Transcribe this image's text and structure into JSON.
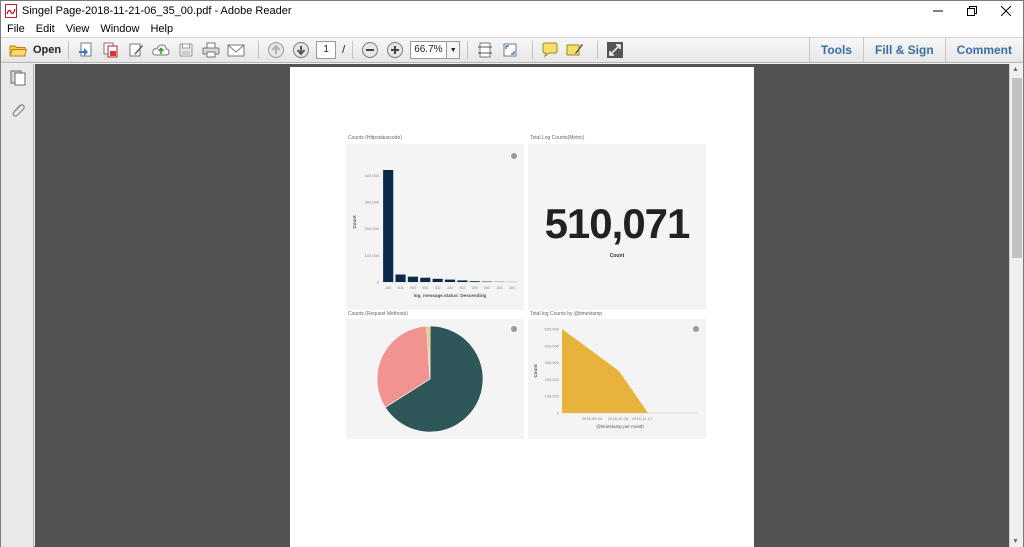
{
  "window": {
    "title": "Singel Page-2018-11-21-06_35_00.pdf - Adobe Reader"
  },
  "menu": [
    "File",
    "Edit",
    "View",
    "Window",
    "Help"
  ],
  "toolbar": {
    "open_label": "Open",
    "page_current": "1",
    "page_separator": "/",
    "zoom": "66.7%",
    "tools_label": "Tools",
    "fillsign_label": "Fill & Sign",
    "comment_label": "Comment"
  },
  "icons": {
    "pdf": "pdf-file-icon",
    "open": "folder-icon",
    "print": "printer-icon",
    "email": "envelope-icon"
  },
  "colors": {
    "bar": "#0b2a4a",
    "pie_main": "#2f5659",
    "pie_second": "#f09391",
    "pie_third": "#e6c76c",
    "area": "#e8b33b",
    "link": "#3b6ea6"
  },
  "dashboard": {
    "p1_title": "Counts (Httpstatuscode)",
    "p2_title": "Total Log Counts(Metric)",
    "p3_title": "Counts (Request Methods)",
    "p4_title": "Total log Counts by @timestamp",
    "metric_value": "510,071",
    "metric_label": "Count"
  },
  "chart_data": [
    {
      "type": "bar",
      "title": "Counts (Httpstatuscode)",
      "xlabel": "log_message.status: Descending",
      "ylabel": "Count",
      "categories": [
        "200",
        "404",
        "403",
        "400",
        "302",
        "304",
        "502",
        "206",
        "500",
        "302",
        "204"
      ],
      "values": [
        420000,
        28000,
        20000,
        16000,
        12000,
        9000,
        6000,
        3000,
        1500,
        800,
        400
      ],
      "yticks": [
        "0",
        "100,000",
        "200,000",
        "300,000",
        "400,000"
      ],
      "ylim": [
        0,
        450000
      ]
    },
    {
      "type": "pie",
      "title": "Counts (Request Methods)",
      "slices": [
        {
          "value": 66
        },
        {
          "value": 33
        },
        {
          "value": 1
        }
      ]
    },
    {
      "type": "area",
      "title": "Total log Counts by @timestamp",
      "xlabel": "@timestamp per month",
      "ylabel": "Count",
      "x": [
        "2018-09-04",
        "2018-10-26",
        "2018-11-17"
      ],
      "values": [
        500000,
        250000,
        0
      ],
      "yticks": [
        "0",
        "100,000",
        "200,000",
        "300,000",
        "400,000",
        "500,000"
      ],
      "ylim": [
        0,
        500000
      ]
    }
  ]
}
